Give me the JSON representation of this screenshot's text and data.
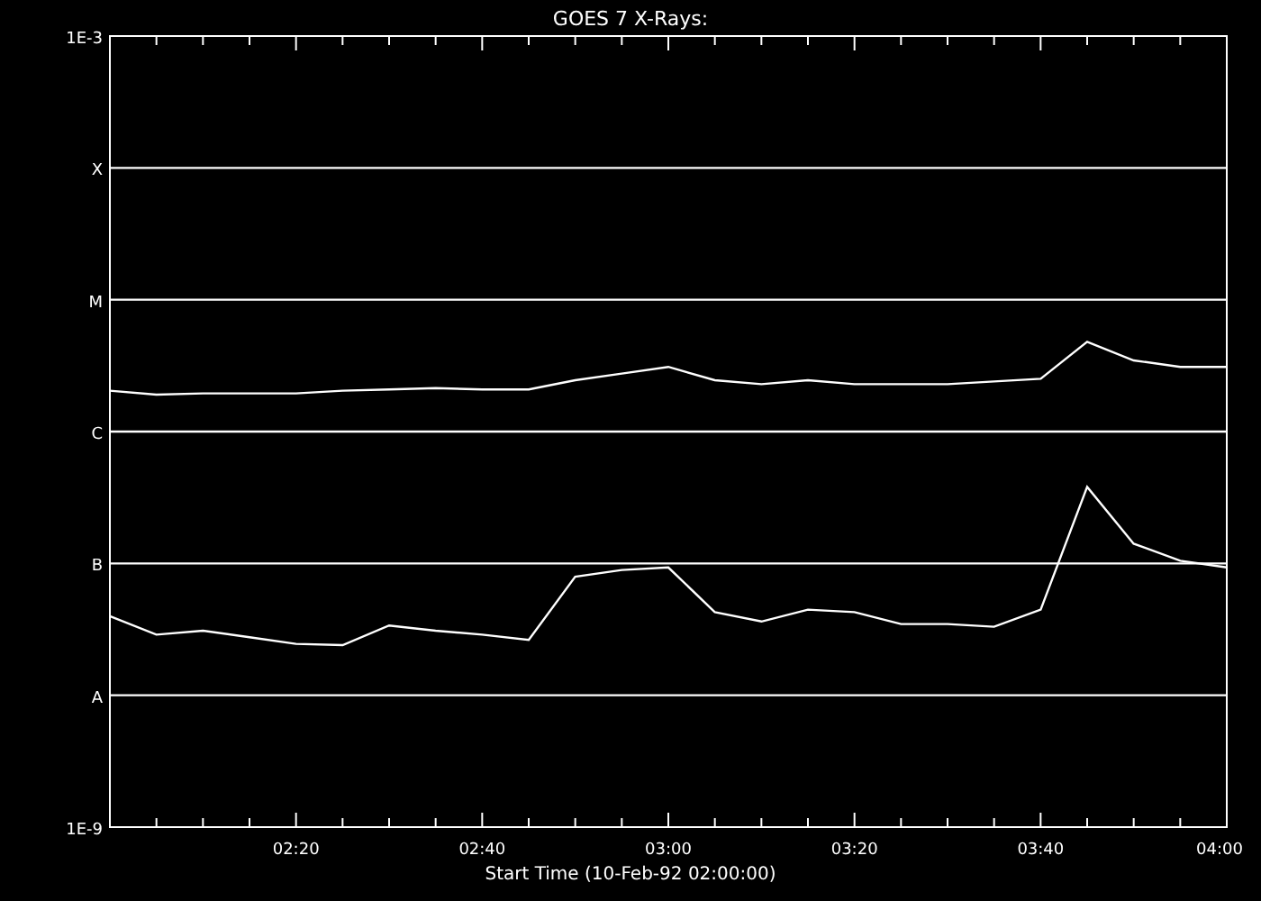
{
  "plot": {
    "title": "GOES 7 X-Rays:",
    "y_axis_labels": [
      "1E-3",
      "X",
      "M",
      "C",
      "B",
      "A",
      "1E-9"
    ],
    "x_axis_labels": [
      "02:20",
      "02:40",
      "03:00",
      "03:20",
      "03:40",
      "04:00"
    ],
    "x_axis_title": "Start Time (10-Feb-92 02:00:00)"
  }
}
